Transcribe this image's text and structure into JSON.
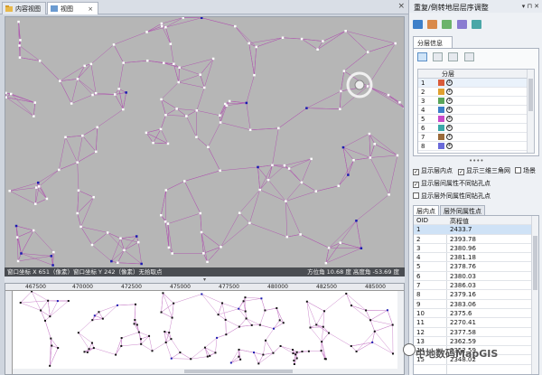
{
  "tabs": [
    {
      "label": "内容视图"
    },
    {
      "label": "视图",
      "close": "×"
    }
  ],
  "doc_close": "×",
  "status": {
    "left": "窗口坐标 X 651（像素）窗口坐标 Y 242（像素）无拾取点",
    "right": "方位角    10.68  度    高度角    -53.69  度"
  },
  "splitter_glyph": "▾",
  "ruler_labels": [
    "467500",
    "470000",
    "472500",
    "475000",
    "477500",
    "480000",
    "482500",
    "485000"
  ],
  "panel": {
    "title": "重复/倒转地层层序调整",
    "controls": "▾ ⊓ ✕",
    "subtab": "分层信息",
    "layer_header": "分层",
    "layers": [
      {
        "n": "1",
        "mark": "①"
      },
      {
        "n": "2",
        "mark": "②"
      },
      {
        "n": "3",
        "mark": "③"
      },
      {
        "n": "4",
        "mark": "④"
      },
      {
        "n": "5",
        "mark": "⑤"
      },
      {
        "n": "6",
        "mark": "⑥"
      },
      {
        "n": "7",
        "mark": "⑦"
      },
      {
        "n": "8",
        "mark": "⑧"
      }
    ],
    "dots": "••••",
    "checkboxes": [
      {
        "label": "显示层内点",
        "checked": true
      },
      {
        "label": "显示三维三角网",
        "checked": true
      },
      {
        "label": "场景",
        "checked": false
      },
      {
        "label": "显示层间属性不同钻孔点",
        "checked": true
      },
      {
        "label": "显示层外同属性同钻孔点",
        "checked": false
      }
    ],
    "bottom_tabs": [
      "层内点",
      "层外同属性点"
    ],
    "table": {
      "headers": [
        "OID",
        "高程值"
      ],
      "rows": [
        [
          "1",
          "2433.7"
        ],
        [
          "2",
          "2393.78"
        ],
        [
          "3",
          "2380.96"
        ],
        [
          "4",
          "2381.18"
        ],
        [
          "5",
          "2378.76"
        ],
        [
          "6",
          "2380.03"
        ],
        [
          "7",
          "2386.03"
        ],
        [
          "8",
          "2379.16"
        ],
        [
          "9",
          "2383.06"
        ],
        [
          "10",
          "2375.6"
        ],
        [
          "11",
          "2270.41"
        ],
        [
          "12",
          "2377.58"
        ],
        [
          "13",
          "2362.59"
        ],
        [
          "14",
          "2352.59"
        ],
        [
          "15",
          "2348.02"
        ]
      ]
    }
  },
  "watermark": "中地数码MapGIS",
  "colors": {
    "accent": "#2f6fb3",
    "mesh": "#c04bc0",
    "status": "#4a4d52"
  }
}
